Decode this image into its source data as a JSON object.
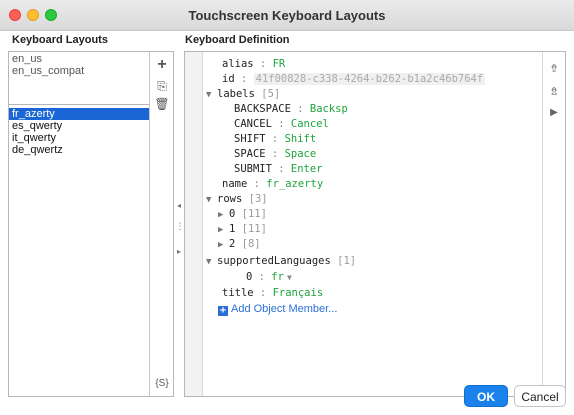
{
  "window": {
    "title": "Touchscreen Keyboard Layouts"
  },
  "left_panel": {
    "title": "Keyboard Layouts",
    "builtin_layouts": [
      "en_us",
      "en_us_compat"
    ],
    "custom_layouts": [
      "fr_azerty",
      "es_qwerty",
      "it_qwerty",
      "de_qwertz"
    ],
    "selected": "fr_azerty",
    "tools": {
      "add": "+",
      "copy": "⎘",
      "delete": "🗑",
      "substitution": "{S}"
    }
  },
  "right_panel": {
    "title": "Keyboard Definition",
    "tree": {
      "alias": {
        "key": "alias",
        "value": "FR"
      },
      "id": {
        "key": "id",
        "value": "41f00828-c338-4264-b262-b1a2c46b764f"
      },
      "labels": {
        "key": "labels",
        "count": "[5]",
        "children": [
          {
            "key": "BACKSPACE",
            "value": "Backsp"
          },
          {
            "key": "CANCEL",
            "value": "Cancel"
          },
          {
            "key": "SHIFT",
            "value": "Shift"
          },
          {
            "key": "SPACE",
            "value": "Space"
          },
          {
            "key": "SUBMIT",
            "value": "Enter"
          }
        ]
      },
      "name": {
        "key": "name",
        "value": "fr_azerty"
      },
      "rows": {
        "key": "rows",
        "count": "[3]",
        "children": [
          {
            "key": "0",
            "count": "[11]"
          },
          {
            "key": "1",
            "count": "[11]"
          },
          {
            "key": "2",
            "count": "[8]"
          }
        ]
      },
      "supportedLanguages": {
        "key": "supportedLanguages",
        "count": "[1]",
        "children": [
          {
            "key": "0",
            "value": "fr"
          }
        ]
      },
      "title": {
        "key": "title",
        "value": "Français"
      },
      "add_member": "Add Object Member..."
    },
    "tools": [
      "export",
      "import",
      "run"
    ]
  },
  "buttons": {
    "ok": "OK",
    "cancel": "Cancel"
  },
  "colors": {
    "accent": "#1a82ea",
    "selection": "#1b66d6",
    "string_value": "#1ea43b"
  }
}
